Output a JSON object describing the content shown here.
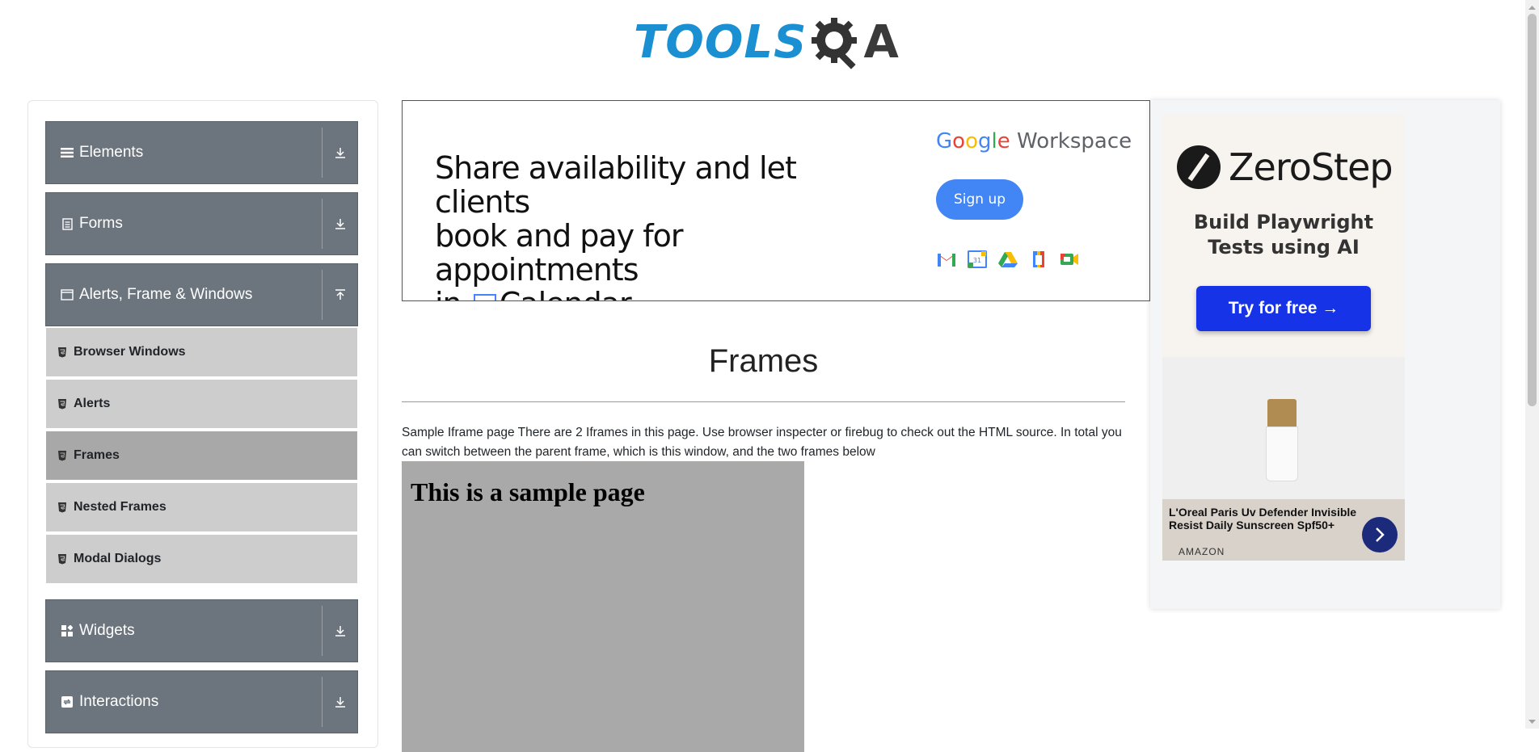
{
  "logo": {
    "text": "TOOLS",
    "suffix": "A"
  },
  "sidebar": {
    "groups": [
      {
        "label": "Elements",
        "icon": "list-icon",
        "expanded": false
      },
      {
        "label": "Forms",
        "icon": "form-icon",
        "expanded": false
      },
      {
        "label": "Alerts, Frame & Windows",
        "icon": "window-icon",
        "expanded": true
      },
      {
        "label": "Widgets",
        "icon": "widgets-icon",
        "expanded": false
      },
      {
        "label": "Interactions",
        "icon": "interactions-icon",
        "expanded": false
      }
    ],
    "subitems": [
      {
        "label": "Browser Windows",
        "active": false
      },
      {
        "label": "Alerts",
        "active": false
      },
      {
        "label": "Frames",
        "active": true
      },
      {
        "label": "Nested Frames",
        "active": false
      },
      {
        "label": "Modal Dialogs",
        "active": false
      }
    ]
  },
  "banner": {
    "headline_1": "Share availability and let clients",
    "headline_2": "book and pay for appointments",
    "headline_3_pre": "in",
    "headline_3_post": "Calendar.",
    "calendar_day": "31",
    "brand_google": "Google",
    "brand_workspace": "Workspace",
    "cta": "Sign up",
    "app_icons": [
      "gmail-icon",
      "calendar-icon",
      "drive-icon",
      "docs-icon",
      "meet-icon"
    ]
  },
  "side_ad": {
    "brand": "ZeroStep",
    "tagline_1": "Build Playwright",
    "tagline_2": "Tests using AI",
    "cta": "Try for free →",
    "product_title": "L'Oreal Paris Uv Defender Invisible Resist Daily Sunscreen Spf50+",
    "product_source": "AMAZON"
  },
  "main": {
    "title": "Frames",
    "description": "Sample Iframe page There are 2 Iframes in this page. Use browser inspecter or firebug to check out the HTML source. In total you can switch between the parent frame, which is this window, and the two frames below",
    "iframe_heading": "This is a sample page"
  },
  "colors": {
    "group_bg": "#6c757d",
    "subitem_bg": "#cdcdcd",
    "subitem_active_bg": "#a8a8a8",
    "logo_blue": "#1a8fd1",
    "iframe_bg": "#a9a9a9",
    "google_blue": "#4285f4",
    "zerostep_blue": "#1633e8"
  }
}
